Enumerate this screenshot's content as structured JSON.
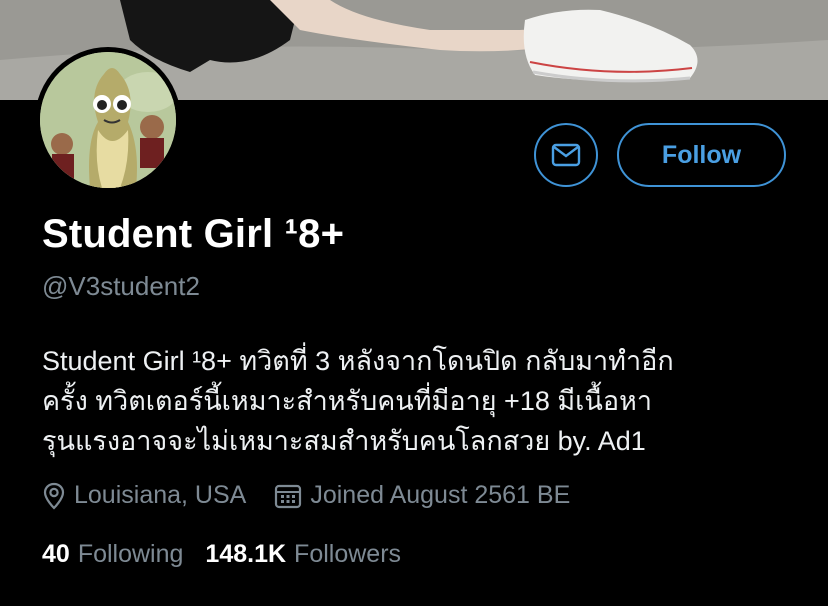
{
  "profile": {
    "name": "Student Girl ¹8+",
    "handle": "@V3student2",
    "bio_lines": [
      "Student Girl ¹8+ ทวิตที่ 3 หลังจากโดนปิด กลับมาทำอีก",
      "ครั้ง ทวิตเตอร์นี้เหมาะสำหรับคนที่มีอายุ +18 มีเนื้อหา",
      "รุนแรงอาจจะไม่เหมาะสมสำหรับคนโลกสวย by. Ad1"
    ],
    "location": "Louisiana, USA",
    "joined": "Joined August 2561 BE"
  },
  "actions": {
    "follow_label": "Follow"
  },
  "stats": {
    "following_count": "40",
    "following_label": "Following",
    "followers_count": "148.1K",
    "followers_label": "Followers"
  },
  "colors": {
    "accent": "#3f93d6",
    "secondary_text": "#7e8a94",
    "background": "#000000"
  },
  "icons": {
    "message": "envelope-icon",
    "location": "location-pin-icon",
    "joined": "calendar-icon"
  }
}
